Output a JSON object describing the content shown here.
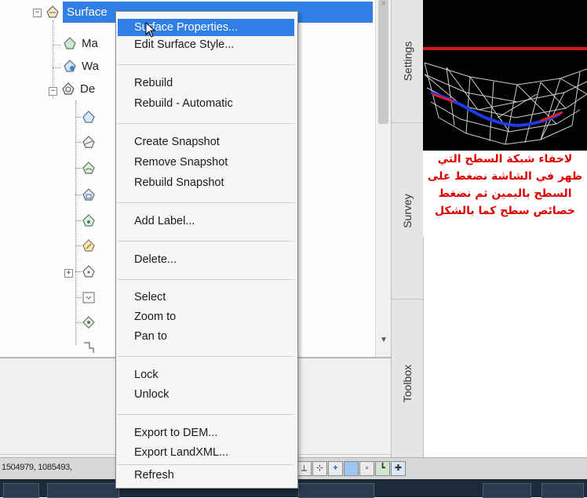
{
  "tree": {
    "surface_label": "Surface",
    "children": [
      {
        "label": "Ma"
      },
      {
        "label": "Wa"
      },
      {
        "label": "De"
      }
    ]
  },
  "side_tabs": [
    "Settings",
    "Survey",
    "Toolbox"
  ],
  "annotation": {
    "lines": [
      "لاخفاء شبكة السطح التي",
      "ظهر في الشاشة نضغط على",
      "السطح باليمين ثم نضغط",
      "خصائص سطح كما بالشكل"
    ],
    "color": "#e00000"
  },
  "context_menu": {
    "groups": [
      [
        "Surface Properties...",
        "Edit Surface Style..."
      ],
      [
        "Rebuild",
        "Rebuild - Automatic"
      ],
      [
        "Create Snapshot",
        "Remove Snapshot",
        "Rebuild Snapshot"
      ],
      [
        "Add Label..."
      ],
      [
        "Delete..."
      ],
      [
        "Select",
        "Zoom to",
        "Pan to"
      ],
      [
        "Lock",
        "Unlock"
      ],
      [
        "Export to DEM...",
        "Export LandXML..."
      ],
      [
        "Refresh"
      ]
    ],
    "highlighted_item": "Surface Properties...",
    "highlight_color": "#2f7fe6"
  },
  "status_bar": {
    "coordinates": "1504979, 1085493,"
  }
}
